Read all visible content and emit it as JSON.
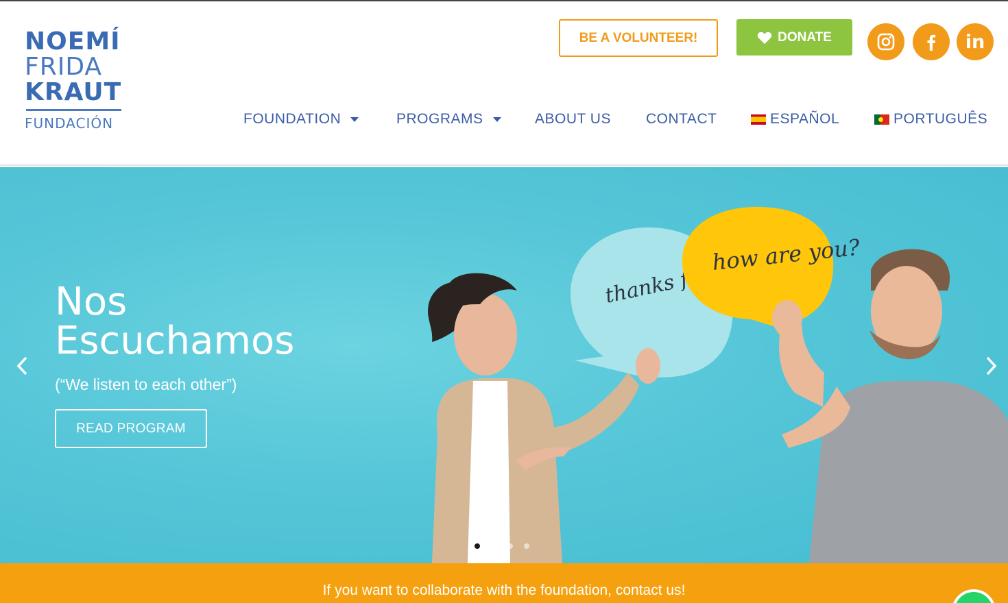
{
  "logo": {
    "line1": "NOEMÍ",
    "line2": "FRIDA",
    "line3": "KRAUT",
    "line4": "FUNDACIÓN"
  },
  "header": {
    "volunteer_label": "BE A VOLUNTEER!",
    "donate_label": "DONATE",
    "social": [
      "instagram-icon",
      "facebook-icon",
      "linkedin-icon"
    ]
  },
  "nav": {
    "items": [
      {
        "label": "FOUNDATION",
        "has_dropdown": true
      },
      {
        "label": "PROGRAMS",
        "has_dropdown": true
      },
      {
        "label": "ABOUT US",
        "has_dropdown": false
      },
      {
        "label": "CONTACT",
        "has_dropdown": false
      },
      {
        "label": "ESPAÑOL",
        "flag": "spain-flag-icon"
      },
      {
        "label": "PORTUGUÊS",
        "flag": "portugal-flag-icon"
      }
    ]
  },
  "hero": {
    "title_line1": "Nos",
    "title_line2": "Escuchamos",
    "subtitle": "(“We listen to each other”)",
    "button_label": "READ PROGRAM",
    "bubble_left": "thanks for asking",
    "bubble_right": "how are you?",
    "slides_total": 4,
    "active_slide": 1
  },
  "bottom_bar": {
    "message": "If you want to collaborate with the foundation, contact us!"
  },
  "colors": {
    "brand_blue": "#3b5ca6",
    "orange": "#f29b1b",
    "green": "#8dc540",
    "hero_bg": "#55c6d8",
    "bar_orange": "#f5a00e"
  }
}
